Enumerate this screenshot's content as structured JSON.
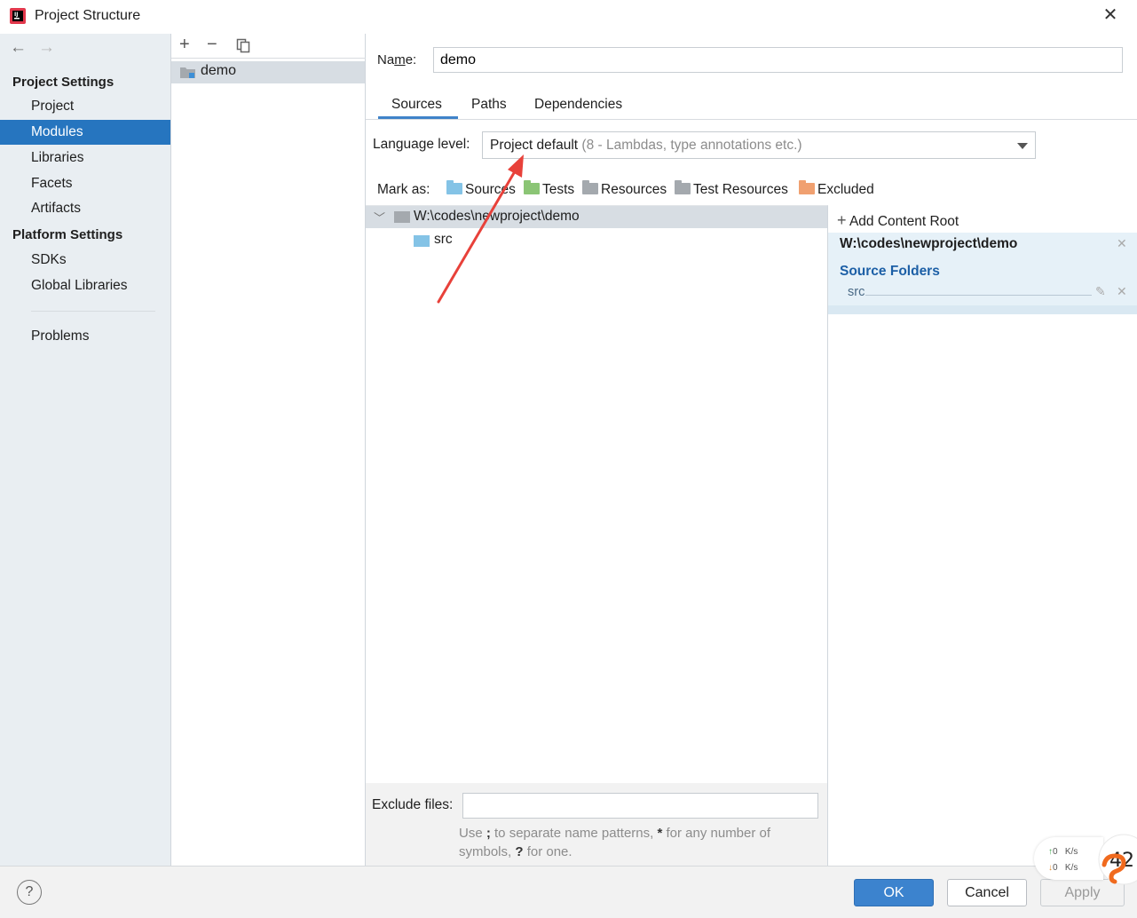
{
  "window": {
    "title": "Project Structure"
  },
  "nav": {
    "back_icon": "arrow-left-icon",
    "forward_icon": "arrow-right-icon",
    "project_settings_header": "Project Settings",
    "platform_settings_header": "Platform Settings",
    "items": [
      {
        "label": "Project"
      },
      {
        "label": "Modules",
        "selected": true
      },
      {
        "label": "Libraries"
      },
      {
        "label": "Facets"
      },
      {
        "label": "Artifacts"
      },
      {
        "label": "SDKs"
      },
      {
        "label": "Global Libraries"
      },
      {
        "label": "Problems"
      }
    ]
  },
  "modules": {
    "toolbar": {
      "add": "+",
      "remove": "−",
      "copy_icon": "copy-icon"
    },
    "list": [
      {
        "label": "demo"
      }
    ]
  },
  "module": {
    "name_label_pre": "Na",
    "name_label_mnemonic": "m",
    "name_label_post": "e:",
    "name_value": "demo",
    "tabs": [
      {
        "label": "Sources",
        "active": true
      },
      {
        "label": "Paths"
      },
      {
        "label": "Dependencies"
      }
    ],
    "language_level_label": "Language level:",
    "language_level_value": "Project default",
    "language_level_hint": "(8 - Lambdas, type annotations etc.)",
    "mark_as_label": "Mark as:",
    "mark_as": [
      {
        "label": "Sources",
        "color": "#84c3e6"
      },
      {
        "label": "Tests",
        "color": "#8bc575"
      },
      {
        "label": "Resources",
        "color": "#a4a9ae"
      },
      {
        "label": "Test Resources",
        "color": "#a4a9ae"
      },
      {
        "label": "Excluded",
        "color": "#f0a070"
      }
    ],
    "tree": {
      "root": "W:\\codes\\newproject\\demo",
      "children": [
        {
          "label": "src"
        }
      ]
    },
    "exclude_files_label": "Exclude files:",
    "exclude_files_value": "",
    "exclude_hint_1": "Use ",
    "exclude_hint_semicolon": ";",
    "exclude_hint_2": " to separate name patterns, ",
    "exclude_hint_star": "*",
    "exclude_hint_3": " for any number of symbols, ",
    "exclude_hint_q": "?",
    "exclude_hint_4": " for one."
  },
  "content_root": {
    "add_label": "Add Content Root",
    "path": "W:\\codes\\newproject\\demo",
    "source_folders_title": "Source Folders",
    "source_folders": [
      "src"
    ]
  },
  "buttons": {
    "help": "?",
    "ok": "OK",
    "cancel": "Cancel",
    "apply": "Apply"
  },
  "net_widget": {
    "up": "0",
    "down": "0",
    "unit": "K/s",
    "badge": "42"
  },
  "colors": {
    "accent": "#2675bf",
    "ok_button": "#3c83ce",
    "annotation_arrow": "#e8413a"
  }
}
